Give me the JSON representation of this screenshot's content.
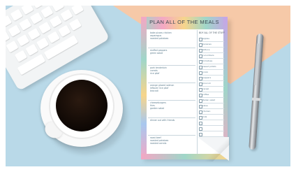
{
  "notepad": {
    "title": "PLAN ALL OF THE MEALS",
    "buy_heading": "BUY ALL OF THE STUFF",
    "meals": [
      "bake pizzas chicken\nasparagus\nroasted potatoes",
      "stuffed peppers\ngreen salad",
      "pork tenderloin\ncarrots\nrice pilaf",
      "orange glazed salmon\nleftover rice pilaf\nbroccoli",
      "cheeseburgers\nfries\ngarden salad",
      "dinner out with friends",
      "roast beef\nroasted potatoes\nroasted carrots"
    ],
    "buy_items": [
      "apples",
      "bananas",
      "lettuce",
      "cucumbers",
      "tomatoes",
      "sweet potato",
      "onion",
      "peppers",
      "broccoli",
      "cereal",
      "coffee",
      "Italian salad",
      "salsa",
      "chicken",
      "milk"
    ]
  },
  "colors": {
    "background_blue": "#b9d9e8",
    "background_peach": "#f6c9a8",
    "coffee": "#1a0e07",
    "title_text": "#3d4a55"
  }
}
